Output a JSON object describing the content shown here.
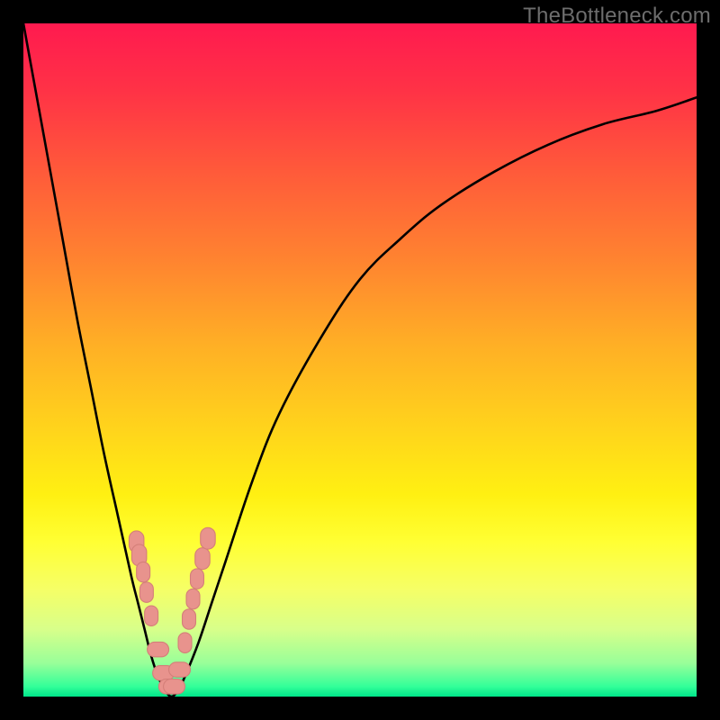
{
  "watermark": "TheBottleneck.com",
  "colors": {
    "frame": "#000000",
    "curve": "#000000",
    "marker_fill": "#e8938d",
    "marker_stroke": "#d47f79"
  },
  "gradient_stops": [
    {
      "offset": 0.0,
      "color": "#ff1a4f"
    },
    {
      "offset": 0.1,
      "color": "#ff3246"
    },
    {
      "offset": 0.22,
      "color": "#ff5a3a"
    },
    {
      "offset": 0.35,
      "color": "#ff8330"
    },
    {
      "offset": 0.48,
      "color": "#ffb025"
    },
    {
      "offset": 0.6,
      "color": "#ffd31c"
    },
    {
      "offset": 0.7,
      "color": "#fff012"
    },
    {
      "offset": 0.77,
      "color": "#ffff33"
    },
    {
      "offset": 0.84,
      "color": "#f6ff66"
    },
    {
      "offset": 0.9,
      "color": "#d8ff8a"
    },
    {
      "offset": 0.95,
      "color": "#99ff99"
    },
    {
      "offset": 0.985,
      "color": "#33ff99"
    },
    {
      "offset": 1.0,
      "color": "#00e58a"
    }
  ],
  "chart_data": {
    "type": "line",
    "title": "",
    "xlabel": "",
    "ylabel": "",
    "xlim": [
      0,
      100
    ],
    "ylim": [
      0,
      100
    ],
    "series": [
      {
        "name": "bottleneck-curve",
        "x": [
          0,
          2,
          4,
          6,
          8,
          10,
          12,
          14,
          16,
          17,
          18,
          19,
          20,
          21,
          22,
          23,
          24,
          26,
          28,
          30,
          34,
          38,
          44,
          50,
          56,
          62,
          70,
          78,
          86,
          94,
          100
        ],
        "y": [
          100,
          89,
          78,
          67,
          56,
          46,
          36,
          27,
          18,
          14,
          10,
          6,
          3,
          1,
          0,
          1,
          3,
          8,
          14,
          20,
          32,
          42,
          53,
          62,
          68,
          73,
          78,
          82,
          85,
          87,
          89
        ]
      }
    ],
    "markers": {
      "name": "highlighted-points",
      "x": [
        16.8,
        17.2,
        17.8,
        18.3,
        19.0,
        20.0,
        20.8,
        21.7,
        22.4,
        23.2,
        24.0,
        24.6,
        25.2,
        25.8,
        26.6,
        27.4
      ],
      "y": [
        23.0,
        21.0,
        18.5,
        15.5,
        12.0,
        7.0,
        3.5,
        1.5,
        1.5,
        4.0,
        8.0,
        11.5,
        14.5,
        17.5,
        20.5,
        23.5
      ],
      "rx": [
        1.1,
        1.1,
        1.0,
        1.0,
        1.0,
        1.6,
        1.6,
        1.6,
        1.6,
        1.6,
        1.0,
        1.0,
        1.0,
        1.0,
        1.1,
        1.1
      ],
      "ry": [
        1.6,
        1.6,
        1.5,
        1.5,
        1.5,
        1.1,
        1.1,
        1.1,
        1.1,
        1.1,
        1.5,
        1.5,
        1.5,
        1.5,
        1.6,
        1.6
      ]
    }
  }
}
